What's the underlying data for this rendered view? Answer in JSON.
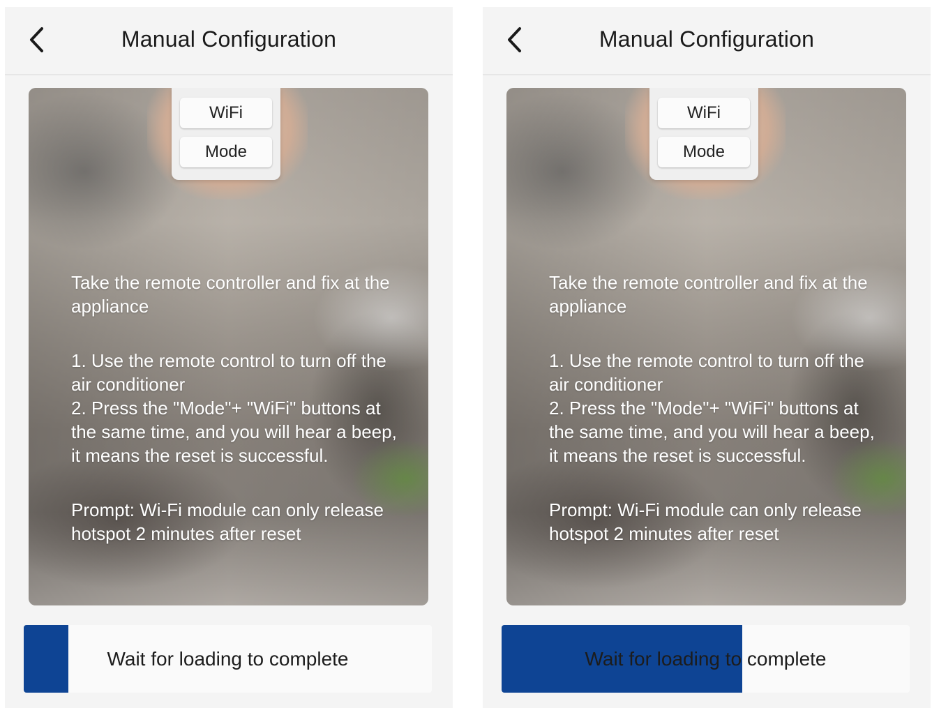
{
  "colors": {
    "accent": "#0e4494",
    "header_bg": "#f4f4f4"
  },
  "screens": [
    {
      "header": {
        "title": "Manual Configuration",
        "back_icon": "chevron-left-icon"
      },
      "remote": {
        "key1": "WiFi",
        "key2": "Mode"
      },
      "instructions": {
        "intro": "Take the remote controller and fix at the appliance",
        "step1": "1. Use the remote control to turn off the air conditioner",
        "step2": "2. Press the \"Mode\"+ \"WiFi\" buttons at the same time, and you will hear a beep, it means the reset is successful.",
        "prompt": "Prompt: Wi-Fi module can only release hotspot 2 minutes after reset"
      },
      "progress": {
        "label": "Wait for loading to complete",
        "fraction": 0.11
      }
    },
    {
      "header": {
        "title": "Manual Configuration",
        "back_icon": "chevron-left-icon"
      },
      "remote": {
        "key1": "WiFi",
        "key2": "Mode"
      },
      "instructions": {
        "intro": "Take the remote controller and fix at the appliance",
        "step1": "1. Use the remote control to turn off the air conditioner",
        "step2": "2. Press the \"Mode\"+ \"WiFi\" buttons at the same time, and you will hear a beep, it means the reset is successful.",
        "prompt": "Prompt: Wi-Fi module can only release hotspot 2 minutes after reset"
      },
      "progress": {
        "label": "Wait for loading to complete",
        "fraction": 0.59
      }
    }
  ]
}
